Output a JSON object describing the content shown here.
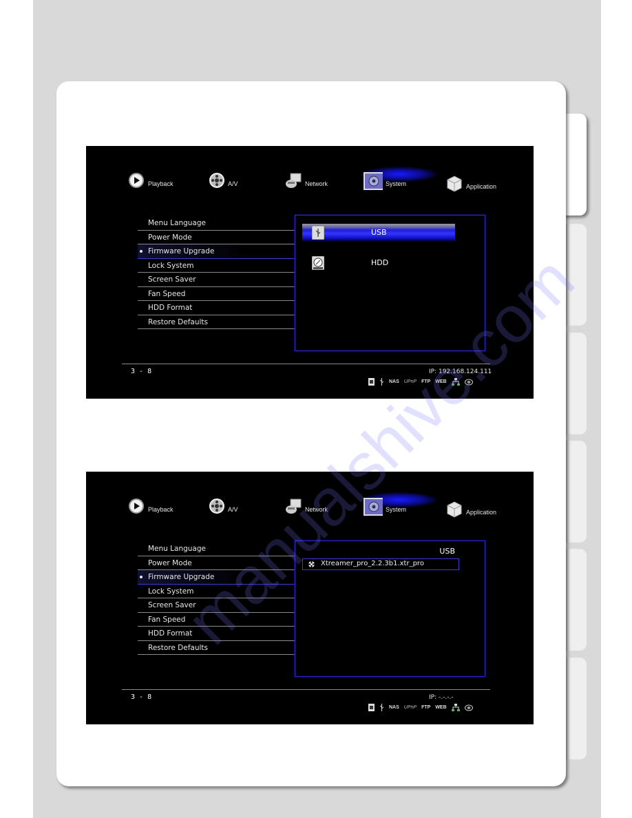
{
  "watermark": "manualshive.com",
  "side_tabs": [
    {
      "state": "active"
    },
    {
      "state": "inactive"
    },
    {
      "state": "inactive"
    },
    {
      "state": "inactive"
    },
    {
      "state": "inactive"
    },
    {
      "state": "inactive"
    }
  ],
  "screens": [
    {
      "nav": [
        {
          "label": "Playback",
          "icon": "play-icon"
        },
        {
          "label": "A/V",
          "icon": "film-reel-icon"
        },
        {
          "label": "Network",
          "icon": "network-icon"
        },
        {
          "label": "System",
          "icon": "system-gear-icon",
          "selected": true
        },
        {
          "label": "Application",
          "icon": "cube-icon"
        }
      ],
      "menu": [
        {
          "label": "Menu Language"
        },
        {
          "label": "Power Mode"
        },
        {
          "label": "Firmware Upgrade",
          "selected": true
        },
        {
          "label": "Lock System"
        },
        {
          "label": "Screen Saver"
        },
        {
          "label": "Fan Speed"
        },
        {
          "label": "HDD Format"
        },
        {
          "label": "Restore Defaults"
        }
      ],
      "panel": {
        "devices": [
          {
            "label": "USB",
            "icon": "usb-icon",
            "highlighted": true
          },
          {
            "label": "HDD",
            "icon": "hdd-icon",
            "highlighted": false
          }
        ]
      },
      "footer": {
        "page": "3 - 8",
        "ip": "IP: 192.168.124.111",
        "status": [
          "sd-card",
          "usb",
          "NAS",
          "UPnP",
          "FTP",
          "WEB",
          "network",
          "wifi"
        ]
      }
    },
    {
      "nav": [
        {
          "label": "Playback",
          "icon": "play-icon"
        },
        {
          "label": "A/V",
          "icon": "film-reel-icon"
        },
        {
          "label": "Network",
          "icon": "network-icon"
        },
        {
          "label": "System",
          "icon": "system-gear-icon",
          "selected": true
        },
        {
          "label": "Application",
          "icon": "cube-icon"
        }
      ],
      "menu": [
        {
          "label": "Menu Language"
        },
        {
          "label": "Power Mode"
        },
        {
          "label": "Firmware Upgrade",
          "selected": true
        },
        {
          "label": "Lock System"
        },
        {
          "label": "Screen Saver"
        },
        {
          "label": "Fan Speed"
        },
        {
          "label": "HDD Format"
        },
        {
          "label": "Restore Defaults"
        }
      ],
      "panel": {
        "title": "USB",
        "files": [
          {
            "label": "Xtreamer_pro_2.2.3b1.xtr_pro",
            "icon": "firmware-file-icon"
          }
        ]
      },
      "footer": {
        "page": "3 - 8",
        "ip": "IP: -.-.-.-",
        "status": [
          "sd-card",
          "usb",
          "NAS",
          "UPnP",
          "FTP",
          "WEB",
          "network",
          "wifi"
        ]
      }
    }
  ],
  "status_labels": {
    "nas": "NAS",
    "upnp": "UPnP",
    "ftp": "FTP",
    "web": "WEB"
  }
}
